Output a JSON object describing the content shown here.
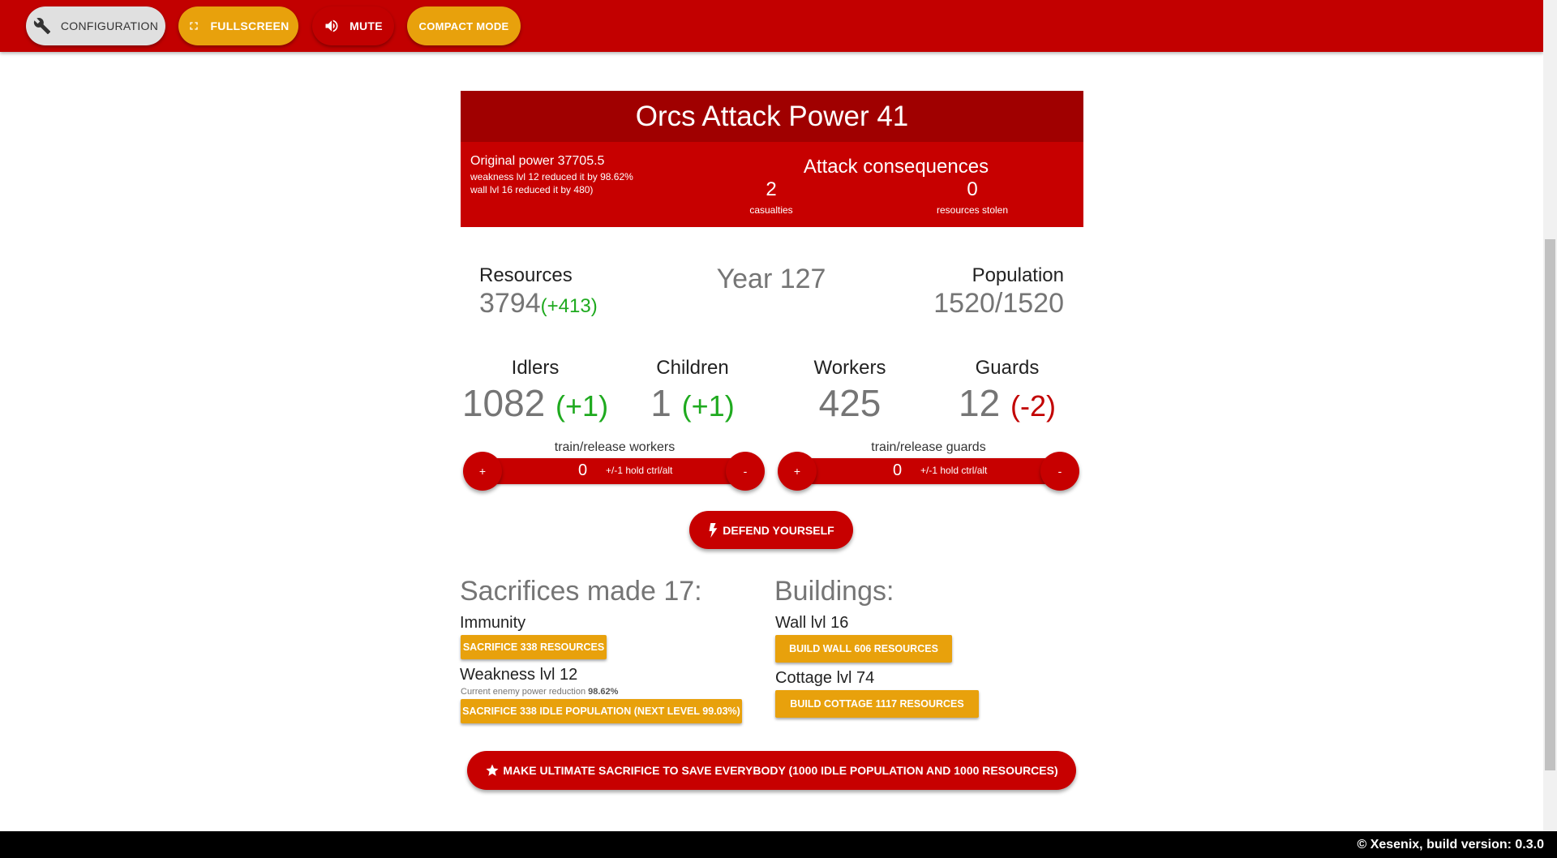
{
  "toolbar": {
    "configuration_label": "Configuration",
    "fullscreen_label": "Fullscreen",
    "mute_label": "Mute",
    "compact_label": "Compact mode"
  },
  "attack": {
    "title": "Orcs Attack Power 41",
    "original_power": "Original power 37705.5",
    "weakness_note": "weakness lvl 12 reduced it by 98.62%",
    "wall_note": "wall lvl 16 reduced it by 480)",
    "consequences_title": "Attack consequences",
    "casualties_value": "2",
    "casualties_label": "casualties",
    "stolen_value": "0",
    "stolen_label": "resources stolen"
  },
  "stats": {
    "resources_label": "Resources",
    "resources_value": "3794",
    "resources_delta": "(+413)",
    "year": "Year 127",
    "population_label": "Population",
    "population_value": "1520/1520"
  },
  "groups": {
    "idlers_label": "Idlers",
    "idlers_value": "1082",
    "idlers_delta": "(+1)",
    "children_label": "Children",
    "children_value": "1",
    "children_delta": "(+1)",
    "workers_label": "Workers",
    "workers_value": "425",
    "guards_label": "Guards",
    "guards_value": "12",
    "guards_delta": "(-2)"
  },
  "train": {
    "workers_label": "train/release workers",
    "workers_value": "0",
    "guards_label": "train/release guards",
    "guards_value": "0",
    "hint": "+/-1 hold ctrl/alt",
    "plus": "+",
    "minus": "-"
  },
  "defend_label": "Defend yourself",
  "sacrifices": {
    "title": "Sacrifices made 17:",
    "immunity_label": "Immunity",
    "immunity_button": "Sacrifice 338 resources",
    "weakness_label": "Weakness lvl 12",
    "weakness_note": "Current enemy power reduction",
    "weakness_note_value": "98.62%",
    "weakness_button": "Sacrifice 338 idle population (next level 99.03%)"
  },
  "buildings": {
    "title": "Buildings:",
    "wall_label": "Wall lvl 16",
    "wall_button": "Build wall 606 resources",
    "cottage_label": "Cottage lvl 74",
    "cottage_button": "Build cottage 1117 resources"
  },
  "ultimate_label": "Make ultimate sacrifice to save everybody (1000 idle population and 1000 resources)",
  "footer": "© Xesenix, build version: 0.3.0",
  "colors": {
    "primary_red": "#c20000",
    "dark_red": "#a00000",
    "amber": "#e8a10c",
    "positive": "#1faa1f"
  },
  "icons": [
    "wrench-icon",
    "fullscreen-icon",
    "volume-icon",
    "bolt-icon",
    "star-icon"
  ]
}
